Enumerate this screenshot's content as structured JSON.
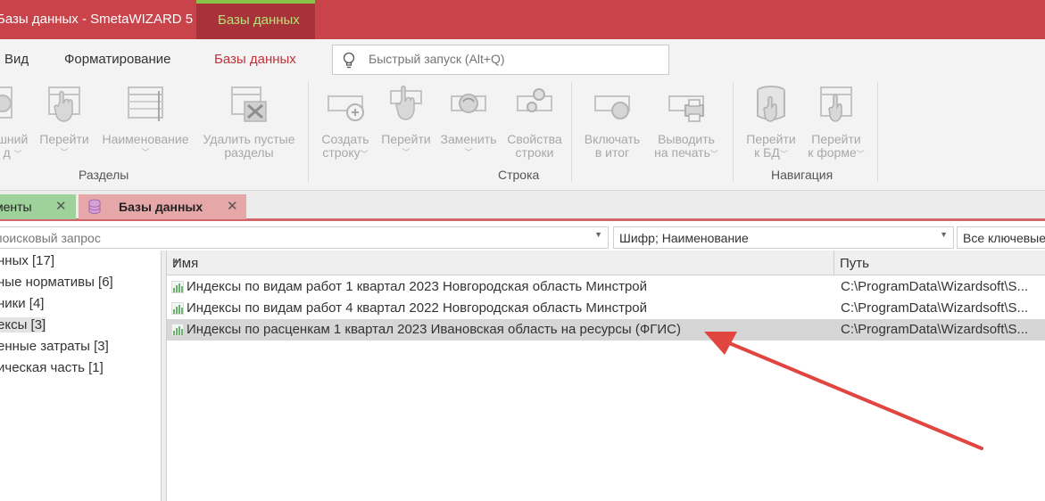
{
  "window": {
    "title": "Базы данных - SmetaWIZARD 5",
    "contextual_tab": "Базы данных"
  },
  "menu": {
    "items": [
      "Вид",
      "Форматирование",
      "Базы данных"
    ],
    "active": "Базы данных",
    "quick_launch_placeholder": "Быстрый запуск (Alt+Q)"
  },
  "ribbon": {
    "groups": [
      {
        "label": "Разделы",
        "buttons": [
          {
            "line1": "шний",
            "line2": "д",
            "icon": "external-db-icon",
            "caret": true
          },
          {
            "line1": "Перейти",
            "line2": "",
            "icon": "hand-pointer-icon",
            "caret": true
          },
          {
            "line1": "Наименование",
            "line2": "",
            "icon": "column-width-icon",
            "caret": true
          },
          {
            "line1": "Удалить пустые",
            "line2": "разделы",
            "icon": "delete-table-icon",
            "caret": false
          }
        ]
      },
      {
        "label": "Строка",
        "buttons": [
          {
            "line1": "Создать",
            "line2": "строку",
            "icon": "add-row-icon",
            "caret": true
          },
          {
            "line1": "Перейти",
            "line2": "",
            "icon": "hand-pointer-icon",
            "caret": true
          },
          {
            "line1": "Заменить",
            "line2": "",
            "icon": "replace-row-icon",
            "caret": true
          },
          {
            "line1": "Свойства",
            "line2": "строки",
            "icon": "row-settings-icon",
            "caret": false
          }
        ]
      },
      {
        "label": "",
        "buttons": [
          {
            "line1": "Включать",
            "line2": "в итог",
            "icon": "include-total-icon",
            "caret": false
          },
          {
            "line1": "Выводить",
            "line2": "на печать",
            "icon": "print-icon",
            "caret": true
          }
        ]
      },
      {
        "label": "Навигация",
        "buttons": [
          {
            "line1": "Перейти",
            "line2": "к БД",
            "icon": "goto-db-icon",
            "caret": true
          },
          {
            "line1": "Перейти",
            "line2": "к форме",
            "icon": "goto-form-icon",
            "caret": true
          }
        ]
      }
    ]
  },
  "doc_tabs": [
    {
      "label": "менты",
      "close": "✕"
    },
    {
      "label": "Базы данных",
      "close": "✕"
    }
  ],
  "filter": {
    "search_value": "поисковый запрос",
    "fields_value": "Шифр; Наименование",
    "keywords_value": "Все ключевые"
  },
  "tree": {
    "items": [
      "нных [17]",
      "ные нормативы [6]",
      "ники [4]",
      "ексы [3]",
      "енные затраты [3]",
      "ическая часть [1]"
    ],
    "selected_index": 3
  },
  "grid": {
    "columns": [
      "Имя",
      "Путь"
    ],
    "rows": [
      {
        "name": "Индексы по видам работ 1 квартал 2023 Новгородская область Минстрой",
        "path": "C:\\ProgramData\\Wizardsoft\\S..."
      },
      {
        "name": "Индексы по видам работ 4 квартал 2022 Новгородская область Минстрой",
        "path": "C:\\ProgramData\\Wizardsoft\\S..."
      },
      {
        "name": "Индексы по расценкам 1 квартал 2023 Ивановская область на ресурсы (ФГИС)",
        "path": "C:\\ProgramData\\Wizardsoft\\S..."
      }
    ],
    "selected_index": 2
  },
  "colors": {
    "title_bar": "#c8434a",
    "contextual_tab": "#a8323a",
    "accent_red": "#c0323a",
    "green_tab": "#9fd29b",
    "red_tab": "#e6a7a9",
    "annotation_arrow": "#e0453f"
  }
}
